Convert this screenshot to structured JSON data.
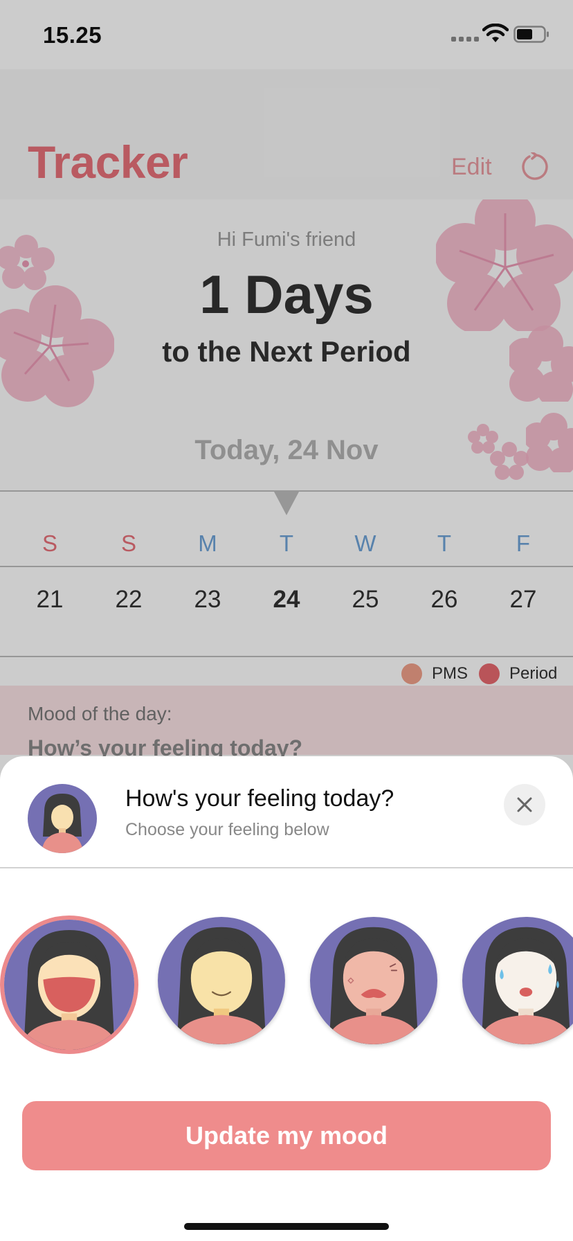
{
  "status_bar": {
    "time": "15.25"
  },
  "header": {
    "title": "Tracker",
    "edit_label": "Edit",
    "refresh_icon": "refresh-icon"
  },
  "hero": {
    "greeting": "Hi Fumi's friend",
    "days_count": "1 Days",
    "days_sub": "to the Next Period",
    "today_label": "Today, 24 Nov"
  },
  "calendar": {
    "weekdays": [
      "S",
      "S",
      "M",
      "T",
      "W",
      "T",
      "F"
    ],
    "dates": [
      "21",
      "22",
      "23",
      "24",
      "25",
      "26",
      "27"
    ],
    "selected_date": "24",
    "weekend_color": "#e8717a",
    "weekday_color": "#6fa3d8"
  },
  "legend": {
    "pms_label": "PMS",
    "pms_color": "#f1a08a",
    "period_label": "Period",
    "period_color": "#e86a70"
  },
  "mood": {
    "label": "Mood of the day:",
    "prompt": "How’s your feeling today?"
  },
  "sheet": {
    "title": "How's your feeling today?",
    "subtitle": "Choose your feeling below",
    "close_icon": "close-icon",
    "options": [
      "laughing",
      "smiling",
      "upset",
      "crying"
    ],
    "selected_option": "laughing",
    "update_label": "Update my mood"
  },
  "colors": {
    "accent": "#e8717a",
    "button": "#ef8c8c",
    "avatar_bg": "#7570b3"
  }
}
